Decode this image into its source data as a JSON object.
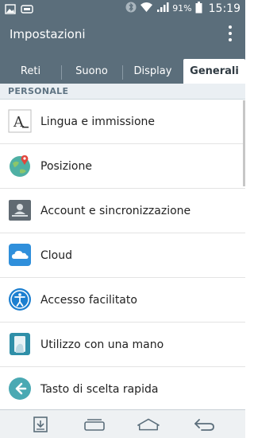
{
  "status_bar": {
    "battery": "91%",
    "time": "15:19"
  },
  "app_bar": {
    "title": "Impostazioni"
  },
  "tabs": [
    {
      "label": "Reti"
    },
    {
      "label": "Suono"
    },
    {
      "label": "Display"
    },
    {
      "label": "Generali",
      "selected": true
    }
  ],
  "section": {
    "title": "PERSONALE"
  },
  "items": [
    {
      "label": "Lingua e immissione",
      "icon": "language-icon"
    },
    {
      "label": "Posizione",
      "icon": "location-icon"
    },
    {
      "label": "Account e sincronizzazione",
      "icon": "account-sync-icon"
    },
    {
      "label": "Cloud",
      "icon": "cloud-icon"
    },
    {
      "label": "Accesso facilitato",
      "icon": "accessibility-icon"
    },
    {
      "label": "Utilizzo con una mano",
      "icon": "one-hand-icon"
    },
    {
      "label": "Tasto di scelta rapida",
      "icon": "shortcut-key-icon"
    }
  ],
  "colors": {
    "app_bar": "#5b6e7b",
    "section_bg": "#eaeff3",
    "section_text": "#5f7483"
  }
}
